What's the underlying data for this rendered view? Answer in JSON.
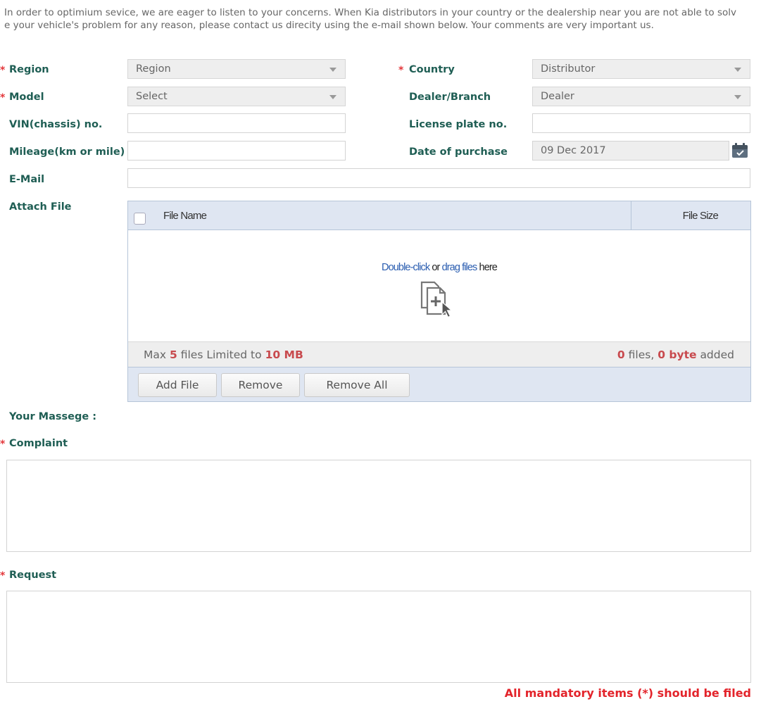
{
  "intro": "In order to optimium sevice, we are eager to listen to your concerns. When Kia distributors in your country or the dealership near you are not able to solv\ne your vehicle's problem for any reason, please contact us direcity using the e-mail shown below. Your comments are very important us.",
  "required_mark": "*",
  "form": {
    "region": {
      "label": "Region",
      "value": "Region"
    },
    "country": {
      "label": "Country",
      "value": "Distributor"
    },
    "model": {
      "label": "Model",
      "value": "Select"
    },
    "dealer": {
      "label": "Dealer/Branch",
      "value": "Dealer"
    },
    "vin": {
      "label": "VIN(chassis) no.",
      "value": ""
    },
    "license": {
      "label": "License plate no.",
      "value": ""
    },
    "mileage": {
      "label": "Mileage(km or mile)",
      "value": ""
    },
    "purchase_date": {
      "label": "Date of  purchase",
      "value": "09 Dec 2017"
    },
    "email": {
      "label": "E-Mail",
      "value": ""
    }
  },
  "attach": {
    "label": "Attach File",
    "col_file_name": "File Name",
    "col_file_size": "File Size",
    "drop_link1": "Double-click",
    "drop_or": "or",
    "drop_link2": "drag files",
    "drop_here": "here",
    "info_max_prefix": "Max",
    "info_max_count": "5",
    "info_limit_text": "files Limited to",
    "info_limit_size": "10 MB",
    "info_count": "0",
    "info_files_text": "files,",
    "info_bytes": "0 byte",
    "info_added": "added",
    "buttons": {
      "add": "Add File",
      "remove": "Remove",
      "remove_all": "Remove All"
    }
  },
  "message": {
    "heading": "Your Massege :",
    "complaint_label": "Complaint",
    "request_label": "Request"
  },
  "footer_note": "All mandatory items (*) should be filed",
  "colors": {
    "label_green": "#1f5e54",
    "required_red": "#e3373b",
    "accent_red": "#c84a4e",
    "link_blue": "#2a5db0"
  },
  "icons": {
    "select_arrow": "chevron-down-icon",
    "calendar": "calendar-icon",
    "drop": "file-add-icon"
  }
}
